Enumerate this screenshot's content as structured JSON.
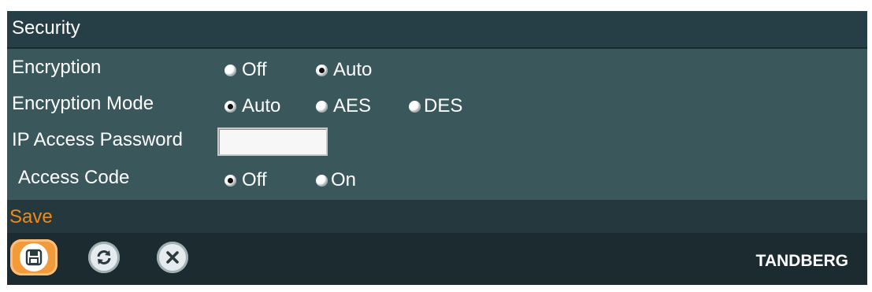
{
  "section": {
    "title": "Security"
  },
  "settings": {
    "encryption": {
      "label": "Encryption",
      "options": [
        "Off",
        "Auto"
      ],
      "selected": "Auto"
    },
    "encryption_mode": {
      "label": "Encryption Mode",
      "options": [
        "Auto",
        "AES",
        "DES"
      ],
      "selected": "Auto"
    },
    "ip_access_password": {
      "label": "IP Access Password",
      "value": ""
    },
    "access_code": {
      "label": "Access Code",
      "options": [
        "Off",
        "On"
      ],
      "selected": "Off"
    }
  },
  "footer": {
    "action_label": "Save",
    "buttons": [
      {
        "name": "save",
        "icon": "floppy-disk-icon",
        "active": true
      },
      {
        "name": "refresh",
        "icon": "refresh-icon",
        "active": false
      },
      {
        "name": "cancel",
        "icon": "close-icon",
        "active": false
      }
    ],
    "brand": "TANDBERG"
  },
  "colors": {
    "panel": "#3a575c",
    "header": "#263e45",
    "toolbar": "#1c2b30",
    "accent": "#f08a16"
  }
}
